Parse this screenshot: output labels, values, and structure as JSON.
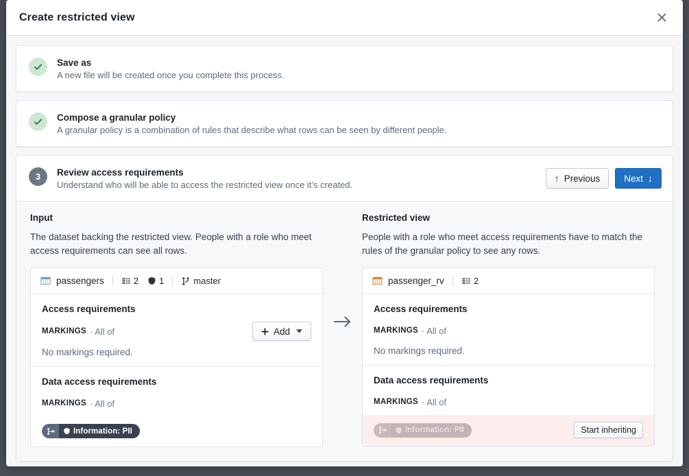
{
  "dialog": {
    "title": "Create restricted view",
    "close_icon": "close-icon"
  },
  "steps": [
    {
      "id": "save-as",
      "state": "complete",
      "badge_icon": "check-icon",
      "title": "Save as",
      "description": "A new file will be created once you complete this process."
    },
    {
      "id": "compose-granular-policy",
      "state": "complete",
      "badge_icon": "check-icon",
      "title": "Compose a granular policy",
      "description": "A granular policy is a combination of rules that describe what rows can be seen by different people."
    },
    {
      "id": "review-access-requirements",
      "state": "active",
      "badge_number": "3",
      "title": "Review access requirements",
      "description": "Understand who will be able to access the restricted view once it’s created."
    }
  ],
  "nav": {
    "previous_label": "Previous",
    "previous_icon": "arrow-up-icon",
    "next_label": "Next",
    "next_icon": "arrow-down-icon"
  },
  "transition": {
    "icon": "arrow-right-icon"
  },
  "input_panel": {
    "title": "Input",
    "description": "The dataset backing the restricted view. People with a role who meet access requirements can see all rows.",
    "resource": {
      "type_icon": "dataset-table-icon",
      "name": "passengers",
      "meta": [
        {
          "icon": "columns-icon",
          "value": "2"
        },
        {
          "icon": "shield-icon",
          "value": "1"
        }
      ],
      "branch_icon": "git-branch-icon",
      "branch": "master"
    },
    "sections": [
      {
        "id": "access-requirements",
        "title": "Access requirements",
        "label": "MARKINGS",
        "qualifier": "· All of",
        "add_button": {
          "label": "Add",
          "plus_icon": "plus-icon",
          "caret_icon": "caret-down-icon"
        },
        "empty_text": "No markings required.",
        "markings": []
      },
      {
        "id": "data-access-requirements",
        "title": "Data access requirements",
        "label": "MARKINGS",
        "qualifier": "· All of",
        "empty_text": "",
        "markings": [
          {
            "inherit_icon": "inheritance-icon",
            "shield_icon": "shield-icon",
            "label": "Information: PII",
            "muted": false
          }
        ]
      }
    ]
  },
  "restricted_panel": {
    "title": "Restricted view",
    "description": "People with a role who meet access requirements have to match the rules of the granular policy to see any rows.",
    "resource": {
      "type_icon": "restricted-view-icon",
      "name": "passenger_rv",
      "meta": [
        {
          "icon": "columns-icon",
          "value": "2"
        }
      ],
      "branch_icon": "",
      "branch": ""
    },
    "sections": [
      {
        "id": "access-requirements",
        "title": "Access requirements",
        "label": "MARKINGS",
        "qualifier": "· All of",
        "empty_text": "No markings required.",
        "markings": []
      },
      {
        "id": "data-access-requirements",
        "title": "Data access requirements",
        "label": "MARKINGS",
        "qualifier": "· All of",
        "empty_text": "",
        "warning": true,
        "start_inheriting_label": "Start inheriting",
        "markings": [
          {
            "inherit_icon": "inheritance-icon",
            "shield_icon": "shield-icon",
            "label": "Information: PII",
            "muted": true
          }
        ]
      }
    ]
  },
  "colors": {
    "primary": "#1f6fc4",
    "complete": "#cfe8d6",
    "complete_check": "#2f7a46",
    "step_badge": "#6b7686",
    "warning_bg": "#fdeeee",
    "dataset_icon": "#5aa8e0",
    "restricted_icon": "#e08a33",
    "marking_dark": "#394150"
  }
}
